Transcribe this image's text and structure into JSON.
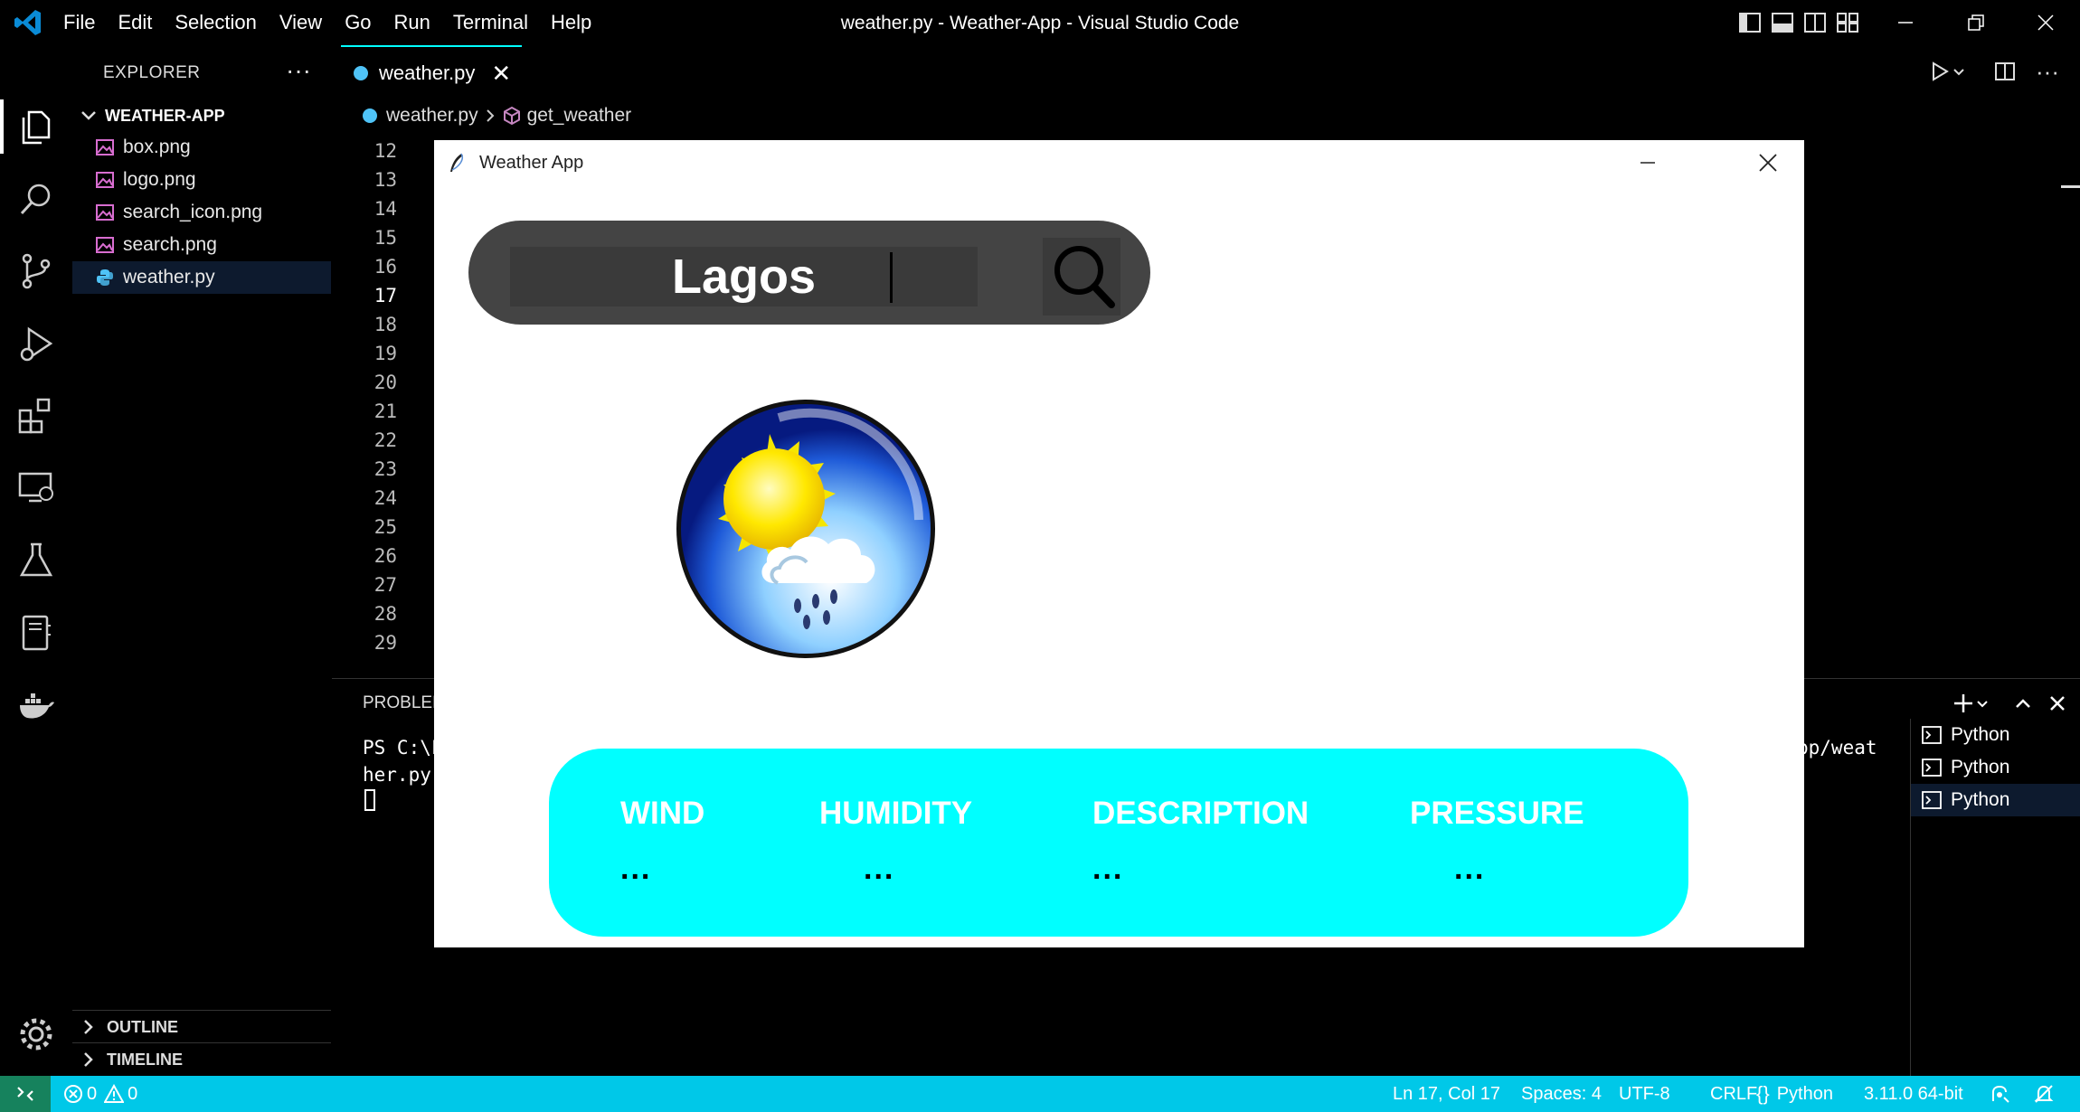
{
  "window": {
    "title": "weather.py - Weather-App - Visual Studio Code",
    "menu": [
      "File",
      "Edit",
      "Selection",
      "View",
      "Go",
      "Run",
      "Terminal",
      "Help"
    ]
  },
  "explorer": {
    "title": "EXPLORER",
    "folder": "WEATHER-APP",
    "files": [
      {
        "name": "box.png",
        "icon": "image-icon"
      },
      {
        "name": "logo.png",
        "icon": "image-icon"
      },
      {
        "name": "search_icon.png",
        "icon": "image-icon"
      },
      {
        "name": "search.png",
        "icon": "image-icon"
      },
      {
        "name": "weather.py",
        "icon": "python-icon",
        "active": true
      }
    ],
    "outline": "OUTLINE",
    "timeline": "TIMELINE"
  },
  "editor": {
    "tab": "weather.py",
    "breadcrumb": {
      "file": "weather.py",
      "symbol": "get_weather"
    },
    "line_numbers": [
      "12",
      "13",
      "14",
      "15",
      "16",
      "17",
      "18",
      "19",
      "20",
      "21",
      "22",
      "23",
      "24",
      "25",
      "26",
      "27",
      "28",
      "29"
    ],
    "current_line": "17"
  },
  "panel": {
    "tab": "PROBLEM",
    "terminal_lines": [
      "PS C:\\F",
      "her.py"
    ],
    "terminal_right": "pp/weat",
    "terminals": [
      "Python",
      "Python",
      "Python"
    ]
  },
  "statusbar": {
    "errors": "0",
    "warnings": "0",
    "position": "Ln 17, Col 17",
    "spaces": "Spaces: 4",
    "encoding": "UTF-8",
    "eol": "CRLF",
    "language": "Python",
    "interpreter": "3.11.0 64-bit",
    "color": "#00c8e8"
  },
  "app": {
    "title": "Weather App",
    "search_value": "Lagos",
    "info": [
      {
        "label": "WIND",
        "value": "..."
      },
      {
        "label": "HUMIDITY",
        "value": "..."
      },
      {
        "label": "DESCRIPTION",
        "value": "..."
      },
      {
        "label": "PRESSURE",
        "value": "..."
      }
    ],
    "accent": "#00ffff"
  }
}
